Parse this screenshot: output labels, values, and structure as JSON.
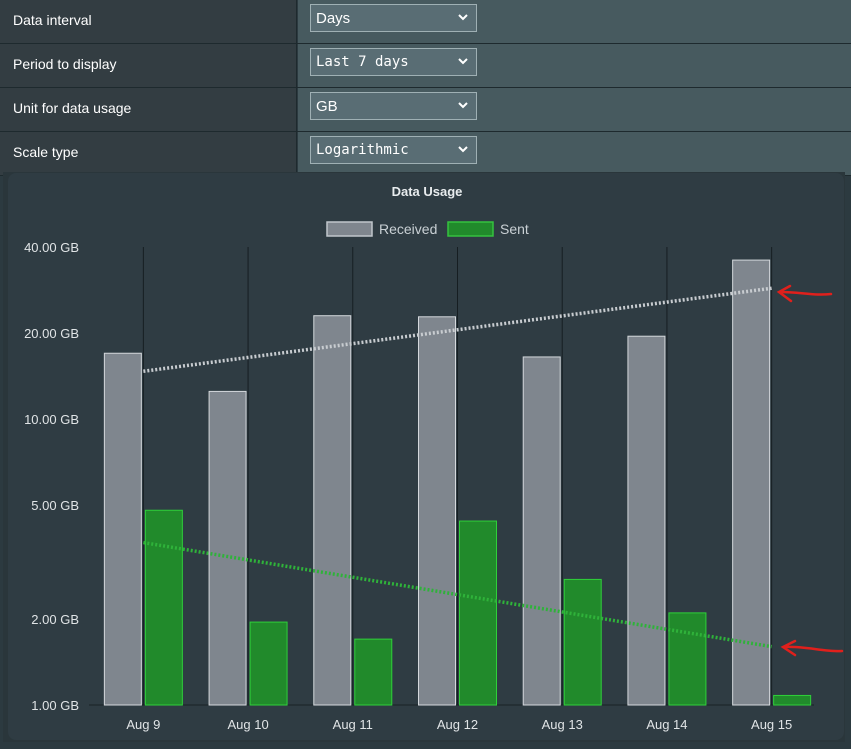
{
  "settings": [
    {
      "label": "Data interval",
      "value": "Days",
      "mono": false
    },
    {
      "label": "Period to display",
      "value": "Last 7 days",
      "mono": true
    },
    {
      "label": "Unit for data usage",
      "value": "GB",
      "mono": false
    },
    {
      "label": "Scale type",
      "value": "Logarithmic",
      "mono": true
    }
  ],
  "icons": {
    "select_arrow": "chevron-down-icon",
    "annotation": "red-arrow-annotation"
  },
  "colors": {
    "received": "#7f868e",
    "sent": "#218a2b",
    "received_trend": "#c8ccd0",
    "sent_trend": "#2fb23a",
    "annotation": "#e0201c"
  },
  "chart_data": {
    "type": "bar",
    "title": "Data Usage",
    "scale": "log",
    "categories": [
      "Aug 9",
      "Aug 10",
      "Aug 11",
      "Aug 12",
      "Aug 13",
      "Aug 14",
      "Aug 15"
    ],
    "series": [
      {
        "name": "Received",
        "values": [
          17.0,
          12.5,
          23.0,
          22.8,
          16.5,
          19.5,
          36.0
        ]
      },
      {
        "name": "Sent",
        "values": [
          4.8,
          1.95,
          1.7,
          4.4,
          2.75,
          2.1,
          1.08
        ]
      }
    ],
    "trendlines": [
      {
        "series": "Received",
        "start": 14.7,
        "end": 28.7
      },
      {
        "series": "Sent",
        "start": 3.7,
        "end": 1.6
      }
    ],
    "yticks": [
      "40.00 GB",
      "20.00 GB",
      "10.00 GB",
      "5.00 GB",
      "2.00 GB",
      "1.00 GB"
    ],
    "ytick_values": [
      40,
      20,
      10,
      5,
      2,
      1
    ],
    "ylim": [
      1,
      40
    ],
    "legend_position": "top-center",
    "grid": "vertical"
  }
}
